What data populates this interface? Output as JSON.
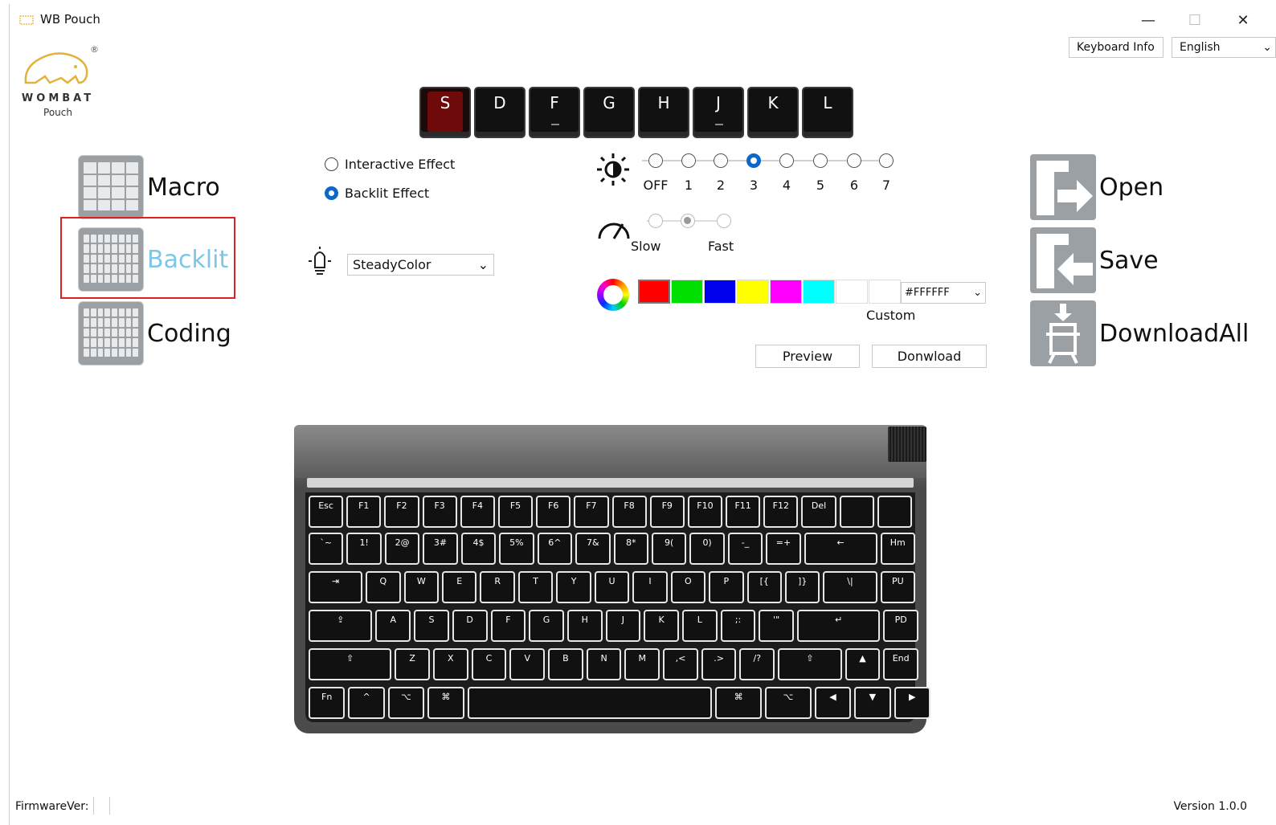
{
  "window": {
    "title": "WB Pouch",
    "min": "—",
    "max": "☐",
    "close": "✕"
  },
  "logo": {
    "brand": "WOMBAT",
    "sub": "Pouch",
    "registered": "®"
  },
  "header": {
    "keyboard_info": "Keyboard Info",
    "language": "English"
  },
  "keycaps": [
    {
      "label": "S",
      "active": true
    },
    {
      "label": "D",
      "active": false
    },
    {
      "label": "F",
      "active": false
    },
    {
      "label": "G",
      "active": false
    },
    {
      "label": "H",
      "active": false
    },
    {
      "label": "J",
      "active": false
    },
    {
      "label": "K",
      "active": false
    },
    {
      "label": "L",
      "active": false
    }
  ],
  "nav": {
    "macro": "Macro",
    "backlit": "Backlit",
    "coding": "Coding"
  },
  "effects": {
    "interactive": "Interactive Effect",
    "backlit": "Backlit Effect",
    "selected": "backlit"
  },
  "mode": {
    "value": "SteadyColor"
  },
  "brightness": {
    "levels": [
      "OFF",
      "1",
      "2",
      "3",
      "4",
      "5",
      "6",
      "7"
    ],
    "selected": "3"
  },
  "speed": {
    "slow": "Slow",
    "fast": "Fast",
    "selected_index": 1,
    "count": 3
  },
  "colors": {
    "swatches": [
      "#ff0000",
      "#00e000",
      "#0000ee",
      "#ffff00",
      "#ff00ff",
      "#00ffff",
      "#ffffff",
      "#ffffff"
    ],
    "selected_index": 0,
    "hex": "#FFFFFF",
    "custom_label": "Custom"
  },
  "actions": {
    "preview": "Preview",
    "download": "Donwload"
  },
  "right": {
    "open": "Open",
    "save": "Save",
    "download_all": "DownloadAll"
  },
  "keyboard_rows": [
    [
      "Esc",
      "F1",
      "F2",
      "F3",
      "F4",
      "F5",
      "F6",
      "F7",
      "F8",
      "F9",
      "F10",
      "F11",
      "F12",
      "Del",
      "",
      ""
    ],
    [
      "`~",
      "1!",
      "2@",
      "3#",
      "4$",
      "5%",
      "6^",
      "7&",
      "8*",
      "9(",
      "0)",
      "-_",
      "=+",
      "←",
      "Hm"
    ],
    [
      "⇥",
      "Q",
      "W",
      "E",
      "R",
      "T",
      "Y",
      "U",
      "I",
      "O",
      "P",
      "[{",
      "]}",
      "\\|",
      "PU"
    ],
    [
      "⇪",
      "A",
      "S",
      "D",
      "F",
      "G",
      "H",
      "J",
      "K",
      "L",
      ";:",
      "'\"",
      "↵",
      "PD"
    ],
    [
      "⇧",
      "Z",
      "X",
      "C",
      "V",
      "B",
      "N",
      "M",
      ",<",
      ".>",
      "/?",
      "⇧",
      "▲",
      "End"
    ],
    [
      "Fn",
      "^",
      "⌥",
      "⌘",
      "",
      "⌘",
      "⌥",
      "◀",
      "▼",
      "▶"
    ]
  ],
  "status": {
    "firmware": "FirmwareVer:",
    "version": "Version 1.0.0"
  }
}
